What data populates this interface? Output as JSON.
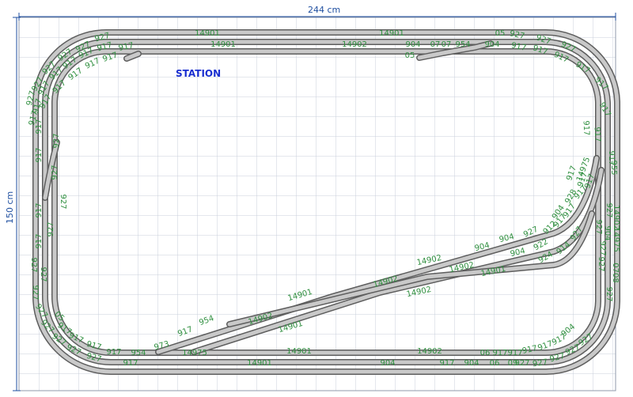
{
  "dimensions": {
    "width_label": "244 cm",
    "height_label": "150 cm"
  },
  "station_label": "STATION",
  "track_labels": [
    "14901",
    "14901",
    "14901",
    "14902",
    "904",
    "07",
    "07",
    "954",
    "05",
    "904",
    "927",
    "927",
    "927",
    "917",
    "917",
    "917",
    "917",
    "917",
    "917",
    "05",
    "917",
    "917",
    "917",
    "917",
    "917",
    "917",
    "917",
    "927",
    "927",
    "927",
    "927",
    "14901",
    "14902",
    "14901",
    "14902",
    "904",
    "904",
    "927",
    "904",
    "904",
    "922",
    "912",
    "917",
    "917",
    "928",
    "14975",
    "955",
    "14902",
    "904",
    "14975",
    "0708",
    "927",
    "924",
    "914",
    "927",
    "14902",
    "14902",
    "14901",
    "14901",
    "14901",
    "14902",
    "14902",
    "904",
    "917",
    "954",
    "954",
    "973",
    "14975",
    "917",
    "917",
    "917",
    "917",
    "917",
    "917",
    "05",
    "06",
    "917",
    "917",
    "917",
    "917",
    "917",
    "904",
    "904",
    "06",
    "09",
    "927",
    "927",
    "927",
    "927",
    "927",
    "927",
    "927",
    "927",
    "927",
    "927",
    "927",
    "927",
    "917",
    "917",
    "917",
    "917",
    "917",
    "917",
    "917",
    "917",
    "917",
    "917",
    "917",
    "917",
    "917",
    "917",
    "917",
    "917",
    "917",
    "927",
    "927",
    "927",
    "927",
    "927",
    "927",
    "927",
    "927",
    "927",
    "927",
    "927"
  ]
}
